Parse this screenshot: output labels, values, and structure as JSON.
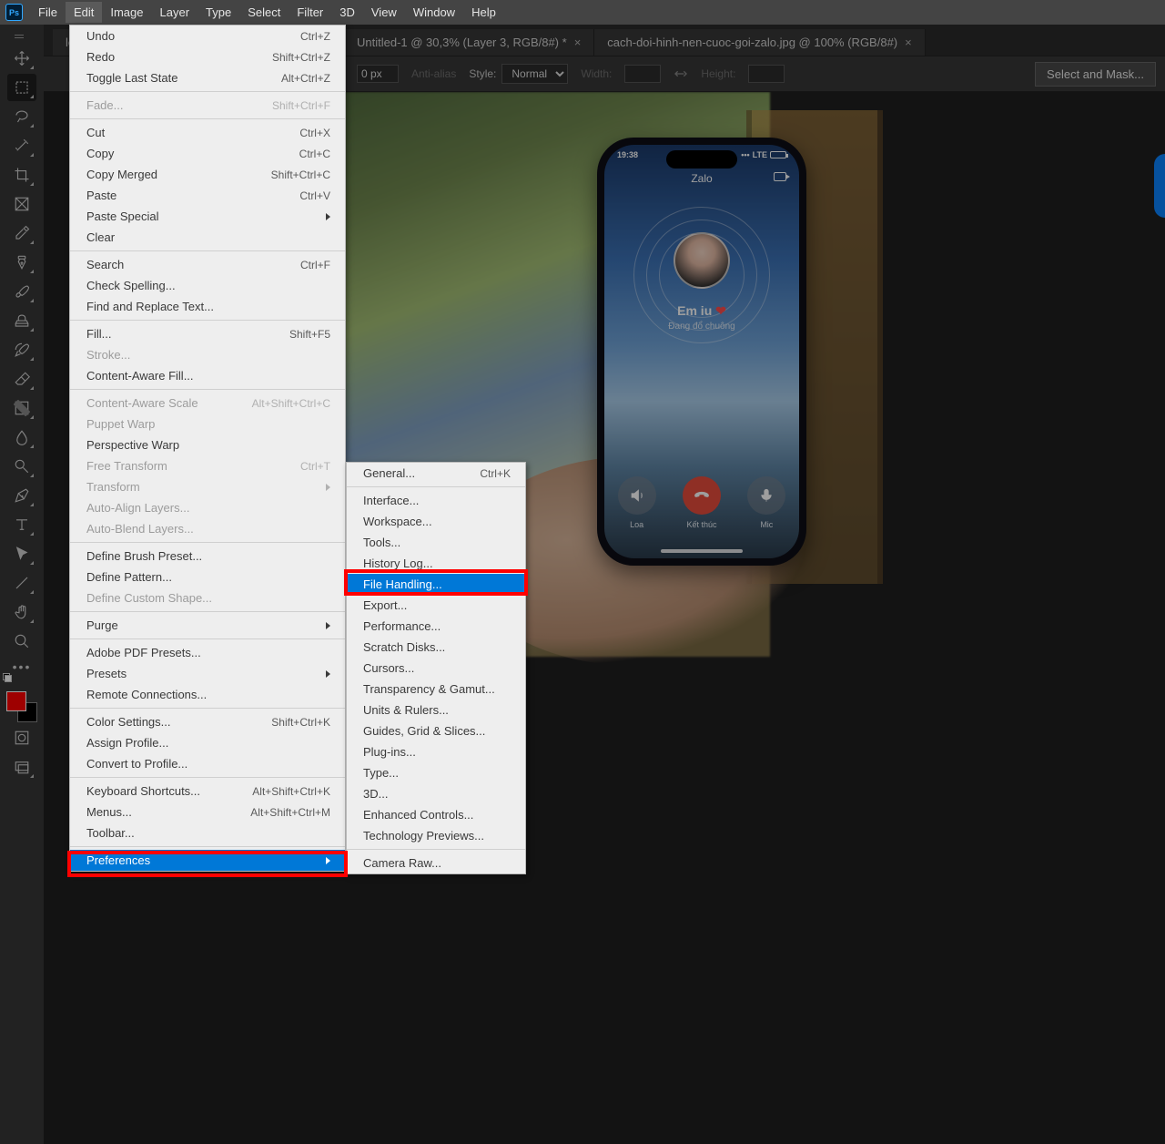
{
  "menubar": [
    "File",
    "Edit",
    "Image",
    "Layer",
    "Type",
    "Select",
    "Filter",
    "3D",
    "View",
    "Window",
    "Help"
  ],
  "tabs": [
    {
      "label": "lo"
    },
    {
      "label": "Untitled-1 @ 30,3% (Layer 3, RGB/8#) *"
    },
    {
      "label": "cach-doi-hinh-nen-cuoc-goi-zalo.jpg @ 100% (RGB/8#)"
    }
  ],
  "optbar": {
    "feather_value": "0 px",
    "antialias": "Anti-alias",
    "style_label": "Style:",
    "style_value": "Normal",
    "width_label": "Width:",
    "height_label": "Height:",
    "mask_btn": "Select and Mask..."
  },
  "edit_menu": [
    {
      "t": "Undo",
      "s": "Ctrl+Z"
    },
    {
      "t": "Redo",
      "s": "Shift+Ctrl+Z"
    },
    {
      "t": "Toggle Last State",
      "s": "Alt+Ctrl+Z"
    },
    {
      "sep": true
    },
    {
      "t": "Fade...",
      "s": "Shift+Ctrl+F",
      "d": true
    },
    {
      "sep": true
    },
    {
      "t": "Cut",
      "s": "Ctrl+X"
    },
    {
      "t": "Copy",
      "s": "Ctrl+C"
    },
    {
      "t": "Copy Merged",
      "s": "Shift+Ctrl+C"
    },
    {
      "t": "Paste",
      "s": "Ctrl+V"
    },
    {
      "t": "Paste Special",
      "sub": true
    },
    {
      "t": "Clear"
    },
    {
      "sep": true
    },
    {
      "t": "Search",
      "s": "Ctrl+F"
    },
    {
      "t": "Check Spelling..."
    },
    {
      "t": "Find and Replace Text..."
    },
    {
      "sep": true
    },
    {
      "t": "Fill...",
      "s": "Shift+F5"
    },
    {
      "t": "Stroke...",
      "d": true
    },
    {
      "t": "Content-Aware Fill..."
    },
    {
      "sep": true
    },
    {
      "t": "Content-Aware Scale",
      "s": "Alt+Shift+Ctrl+C",
      "d": true
    },
    {
      "t": "Puppet Warp",
      "d": true
    },
    {
      "t": "Perspective Warp"
    },
    {
      "t": "Free Transform",
      "s": "Ctrl+T",
      "d": true
    },
    {
      "t": "Transform",
      "sub": true,
      "d": true
    },
    {
      "t": "Auto-Align Layers...",
      "d": true
    },
    {
      "t": "Auto-Blend Layers...",
      "d": true
    },
    {
      "sep": true
    },
    {
      "t": "Define Brush Preset..."
    },
    {
      "t": "Define Pattern..."
    },
    {
      "t": "Define Custom Shape...",
      "d": true
    },
    {
      "sep": true
    },
    {
      "t": "Purge",
      "sub": true
    },
    {
      "sep": true
    },
    {
      "t": "Adobe PDF Presets..."
    },
    {
      "t": "Presets",
      "sub": true
    },
    {
      "t": "Remote Connections..."
    },
    {
      "sep": true
    },
    {
      "t": "Color Settings...",
      "s": "Shift+Ctrl+K"
    },
    {
      "t": "Assign Profile..."
    },
    {
      "t": "Convert to Profile..."
    },
    {
      "sep": true
    },
    {
      "t": "Keyboard Shortcuts...",
      "s": "Alt+Shift+Ctrl+K"
    },
    {
      "t": "Menus...",
      "s": "Alt+Shift+Ctrl+M"
    },
    {
      "t": "Toolbar..."
    },
    {
      "sep": true
    },
    {
      "t": "Preferences",
      "sub": true,
      "hilite": true
    }
  ],
  "pref_menu": [
    {
      "t": "General...",
      "s": "Ctrl+K"
    },
    {
      "sep": true
    },
    {
      "t": "Interface..."
    },
    {
      "t": "Workspace..."
    },
    {
      "t": "Tools..."
    },
    {
      "t": "History Log..."
    },
    {
      "t": "File Handling...",
      "hilite": true
    },
    {
      "t": "Export..."
    },
    {
      "t": "Performance..."
    },
    {
      "t": "Scratch Disks..."
    },
    {
      "t": "Cursors..."
    },
    {
      "t": "Transparency & Gamut..."
    },
    {
      "t": "Units & Rulers..."
    },
    {
      "t": "Guides, Grid & Slices..."
    },
    {
      "t": "Plug-ins..."
    },
    {
      "t": "Type..."
    },
    {
      "t": "3D..."
    },
    {
      "t": "Enhanced Controls..."
    },
    {
      "t": "Technology Previews..."
    },
    {
      "sep": true
    },
    {
      "t": "Camera Raw..."
    }
  ],
  "phone": {
    "time": "19:38",
    "app": "Zalo",
    "name": "Em iu ",
    "status": "Đang đổ chuông",
    "btns": [
      "Loa",
      "Kết thúc",
      "Mic"
    ]
  }
}
